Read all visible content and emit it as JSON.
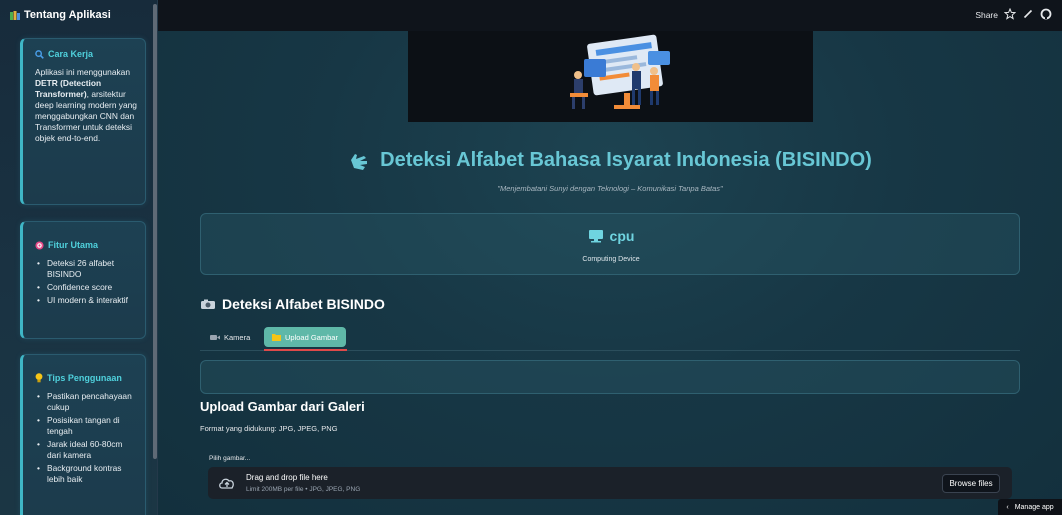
{
  "sidebar": {
    "title": "Tentang Aplikasi",
    "cards": [
      {
        "icon": "magnifier-icon",
        "heading": "Cara Kerja",
        "text_before": "Aplikasi ini menggunakan ",
        "text_bold": "DETR (Detection Transformer)",
        "text_after": ", arsitektur deep learning modern yang menggabungkan CNN dan Transformer untuk deteksi objek end-to-end."
      },
      {
        "icon": "target-icon",
        "heading": "Fitur Utama",
        "items": [
          "Deteksi 26 alfabet BISINDO",
          "Confidence score",
          "UI modern & interaktif"
        ]
      },
      {
        "icon": "lightbulb-icon",
        "heading": "Tips Penggunaan",
        "items": [
          "Pastikan pencahayaan cukup",
          "Posisikan tangan di tengah",
          "Jarak ideal 60-80cm dari kamera",
          "Background kontras lebih baik"
        ]
      }
    ]
  },
  "topbar": {
    "share_label": "Share"
  },
  "main": {
    "title": "Deteksi Alfabet Bahasa Isyarat Indonesia (BISINDO)",
    "subtitle": "\"Menjembatani Sunyi dengan Teknologi – Komunikasi Tanpa Batas\"",
    "device": {
      "name": "cpu",
      "label": "Computing Device"
    },
    "section_heading": "Deteksi Alfabet BISINDO",
    "tabs": [
      {
        "label": "Kamera",
        "active": false
      },
      {
        "label": "Upload Gambar",
        "active": true
      }
    ],
    "upload_heading": "Upload Gambar dari Galeri",
    "formats_text": "Format yang didukung: JPG, JPEG, PNG",
    "uploader": {
      "label": "Pilih gambar...",
      "drop_text": "Drag and drop file here",
      "limit_text": "Limit 200MB per file • JPG, JPEG, PNG",
      "browse_label": "Browse files"
    }
  },
  "footer": {
    "manage_label": "Manage app"
  },
  "colors": {
    "accent": "#68c7d5",
    "card_border": "#3fb6c6",
    "active_tab": "#5fb8a8",
    "tab_underline": "#e04a4a"
  }
}
